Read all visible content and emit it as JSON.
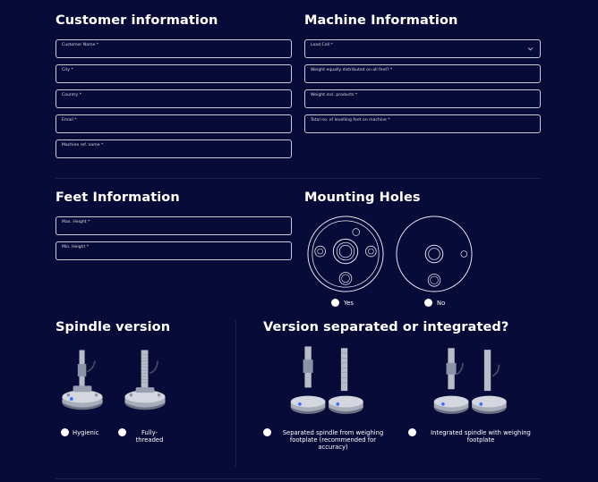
{
  "customer": {
    "title": "Customer information",
    "fields": [
      {
        "label": "Customer Name *",
        "value": ""
      },
      {
        "label": "City *",
        "value": ""
      },
      {
        "label": "Country *",
        "value": ""
      },
      {
        "label": "Email *",
        "value": ""
      },
      {
        "label": "Machine ref. name *",
        "value": ""
      }
    ]
  },
  "machine": {
    "title": "Machine Information",
    "fields": [
      {
        "label": "Load Cell *",
        "value": ""
      },
      {
        "label": "Weight equally distributed on all feet? *",
        "value": ""
      },
      {
        "label": "Weight incl. products *",
        "value": ""
      },
      {
        "label": "Total no. of levelling feet on machine *",
        "value": ""
      }
    ]
  },
  "feet": {
    "title": "Feet Information",
    "fields": [
      {
        "label": "Max. Height *",
        "value": ""
      },
      {
        "label": "Min. Height *",
        "value": ""
      }
    ]
  },
  "mounting": {
    "title": "Mounting Holes",
    "options": [
      {
        "label": "Yes"
      },
      {
        "label": "No"
      }
    ]
  },
  "spindle": {
    "title": "Spindle version",
    "options": [
      {
        "label": "Hygienic"
      },
      {
        "label": "Fully-\nthreaded"
      }
    ]
  },
  "version": {
    "title": "Version separated or integrated?",
    "options": [
      {
        "label": "Separated spindle from weighing\nfootplate (recommended for\naccuracy)"
      },
      {
        "label": "Integrated spindle with weighing\nfootplate"
      }
    ]
  },
  "icons": {
    "dropdown": "chevron-down-icon"
  },
  "colors": {
    "background": "#080a38",
    "border": "#c8cad8",
    "text": "#ffffff"
  }
}
